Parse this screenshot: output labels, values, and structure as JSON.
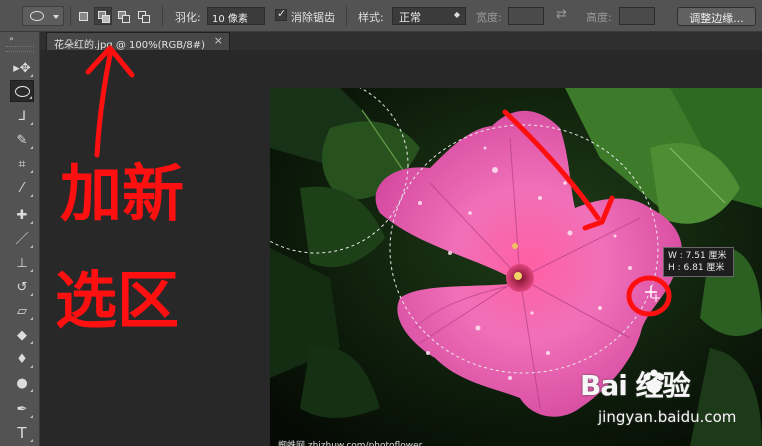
{
  "options_bar": {
    "feather_label": "羽化:",
    "feather_value": "10 像素",
    "antialias_label": "消除锯齿",
    "antialias_checked": "✓",
    "style_label": "样式:",
    "style_value": "正常",
    "width_label": "宽度:",
    "height_label": "高度:",
    "refine_edge_button": "调整边缘..."
  },
  "document_tab": {
    "title": "花朵红的.jpg @ 100%(RGB/8#)",
    "close": "×"
  },
  "toolbar": {
    "collapse_glyph": "»",
    "tools": [
      {
        "name": "move-tool",
        "glyph": "▸✥"
      },
      {
        "name": "elliptical-marquee-tool",
        "glyph": ""
      },
      {
        "name": "lasso-tool",
        "glyph": "ᒧ"
      },
      {
        "name": "quick-selection-tool",
        "glyph": "✎"
      },
      {
        "name": "crop-tool",
        "glyph": "⌗"
      },
      {
        "name": "eyedropper-tool",
        "glyph": "⁄"
      },
      {
        "name": "healing-brush-tool",
        "glyph": "✚"
      },
      {
        "name": "brush-tool",
        "glyph": "／"
      },
      {
        "name": "clone-stamp-tool",
        "glyph": "⊥"
      },
      {
        "name": "history-brush-tool",
        "glyph": "↺"
      },
      {
        "name": "eraser-tool",
        "glyph": "▱"
      },
      {
        "name": "paint-bucket-tool",
        "glyph": "◆"
      },
      {
        "name": "blur-tool",
        "glyph": "♦"
      },
      {
        "name": "dodge-tool",
        "glyph": "●"
      },
      {
        "name": "pen-tool",
        "glyph": "✒"
      },
      {
        "name": "type-tool",
        "glyph": "T"
      }
    ]
  },
  "readout": {
    "width_text": "W : 7.51 厘米",
    "height_text": "H : 6.81 厘米"
  },
  "annotation": {
    "line1": "加新",
    "line2": "选区"
  },
  "watermarks": {
    "left_text": "蜘蛛网 zhizhuw.com/photoflower",
    "logo": "Bai   经验",
    "site": "jingyan.baidu.com"
  },
  "colors": {
    "panel": "#535353",
    "workspace": "#282828",
    "annotation_red": "#ff0000",
    "petal": "#e64fa8"
  }
}
